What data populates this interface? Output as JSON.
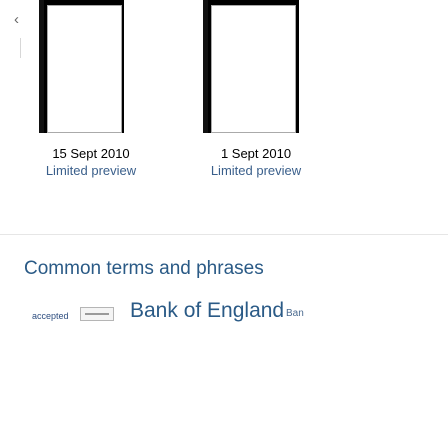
{
  "carousel": {
    "prev_arrow": "‹",
    "books": [
      {
        "date": "15 Sept 2010",
        "preview": "Limited preview"
      },
      {
        "date": "1 Sept 2010",
        "preview": "Limited preview"
      }
    ]
  },
  "terms": {
    "heading": "Common terms and phrases",
    "items": [
      {
        "text": "accepted"
      },
      {
        "text": "Bank of England"
      },
      {
        "text": "Ban"
      }
    ]
  }
}
